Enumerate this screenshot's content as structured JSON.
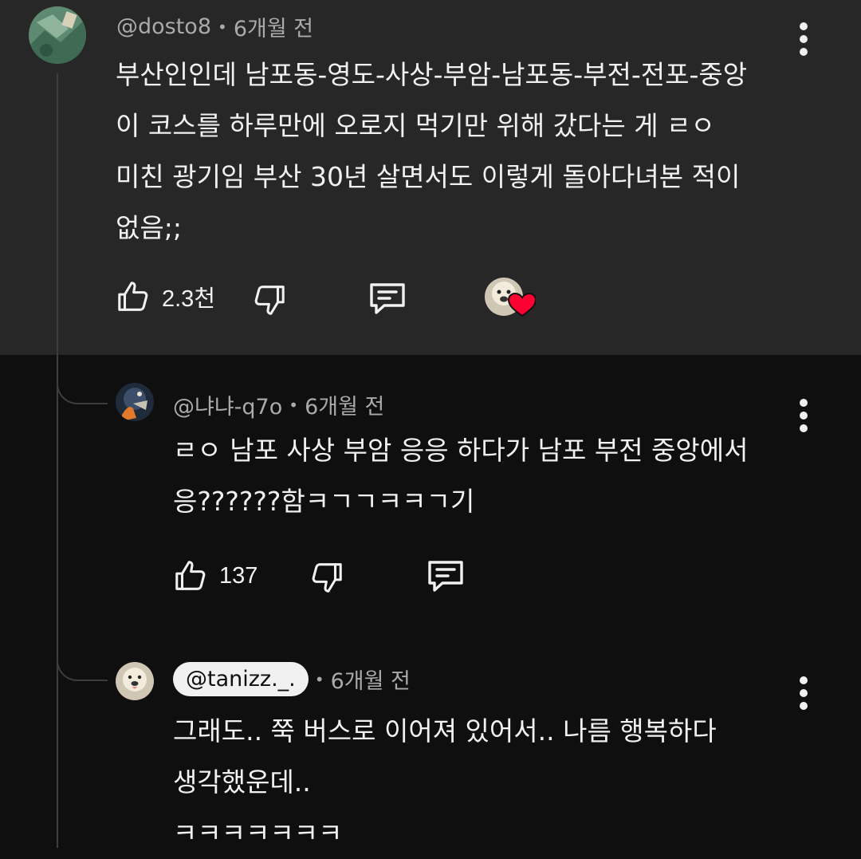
{
  "comments": [
    {
      "handle": "@dosto8",
      "separator": "•",
      "time": "6개월 전",
      "body": "부산인인데 남포동-영도-사상-부암-남포동-부전-전포-중앙\n이 코스를 하루만에 오로지 먹기만 위해 갔다는 게 ㄹㅇ\n미친 광기임 부산 30년 살면서도 이렇게 돌아다녀본 적이\n없음;;",
      "likes": "2.3천",
      "creator_hearted": true
    },
    {
      "handle": "@냐냐-q7o",
      "separator": "•",
      "time": "6개월 전",
      "body": "ㄹㅇ  남포 사상 부암 응응 하다가 남포 부전 중앙에서\n응??????함ㅋㄱㄱㅋㅋㄱ기",
      "likes": "137"
    },
    {
      "handle": "@tanizz._.",
      "separator": "•",
      "time": "6개월 전",
      "body": "그래도.. 쭉 버스로 이어져 있어서.. 나름 행복하다\n생각했운데..\nㅋㅋㅋㅋㅋㅋㅋ"
    }
  ],
  "colors": {
    "highlight_background": "#272727",
    "page_background": "#0f0f0f",
    "heart": "#ff0033",
    "text_primary": "#f1f1f1",
    "text_secondary": "#aaaaaa"
  },
  "icons": [
    "like-icon",
    "dislike-icon",
    "reply-icon",
    "more-vert-icon",
    "heart-icon"
  ]
}
